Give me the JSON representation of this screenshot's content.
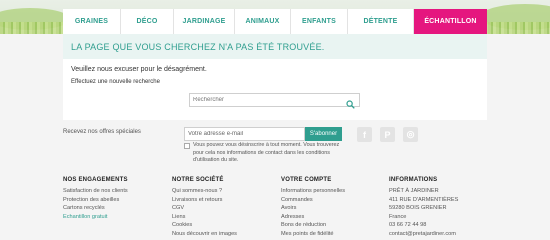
{
  "nav": {
    "items": [
      {
        "label": "GRAINES",
        "active": false
      },
      {
        "label": "DÉCO",
        "active": false
      },
      {
        "label": "JARDINAGE",
        "active": false
      },
      {
        "label": "ANIMAUX",
        "active": false
      },
      {
        "label": "ENFANTS",
        "active": false
      },
      {
        "label": "DÉTENTE",
        "active": false
      },
      {
        "label": "ÉCHANTILLON",
        "active": true
      }
    ]
  },
  "error": {
    "title": "LA PAGE QUE VOUS CHERCHEZ N'A PAS ÉTÉ TROUVÉE.",
    "apology": "Veuillez nous excuser pour le désagrément.",
    "new_search": "Effectuez une nouvelle recherche"
  },
  "search": {
    "placeholder": "Rechercher",
    "icon": "search-icon"
  },
  "newsletter": {
    "label": "Recevez nos offres spéciales",
    "email_placeholder": "Votre adresse e-mail",
    "subscribe_label": "S'abonner",
    "consent": "Vous pouvez vous désinscrire à tout moment. Vous trouverez pour cela nos informations de contact dans les conditions d'utilisation du site."
  },
  "social": [
    {
      "icon": "facebook-icon",
      "glyph": "f"
    },
    {
      "icon": "pinterest-icon",
      "glyph": "P"
    },
    {
      "icon": "instagram-icon",
      "glyph": "◎"
    }
  ],
  "footer": {
    "columns": [
      {
        "title": "NOS ENGAGEMENTS",
        "links": [
          "Satisfaction de nos clients",
          "Protection des abeilles",
          "Cartons recyclés",
          "Echantillon gratuit"
        ],
        "highlight_index": 3
      },
      {
        "title": "NOTRE SOCIÉTÉ",
        "links": [
          "Qui sommes-nous ?",
          "Livraisons et retours",
          "CGV",
          "Liens",
          "Cookies",
          "Nous découvrir en images"
        ]
      },
      {
        "title": "VOTRE COMPTE",
        "links": [
          "Informations personnelles",
          "Commandes",
          "Avoirs",
          "Adresses",
          "Bons de réduction",
          "Mes points de fidélité"
        ]
      },
      {
        "title": "INFORMATIONS",
        "links": [
          "PRÊT À JARDINER",
          "411 RUE D'ARMENTIÈRES",
          "59280 BOIS GRENIER",
          "France",
          "03 66 72 44 98",
          "contact@pretajardiner.com"
        ]
      }
    ]
  },
  "colors": {
    "accent": "#2f9e8f",
    "active_tab": "#e5167f",
    "background": "#f4f4f4"
  }
}
